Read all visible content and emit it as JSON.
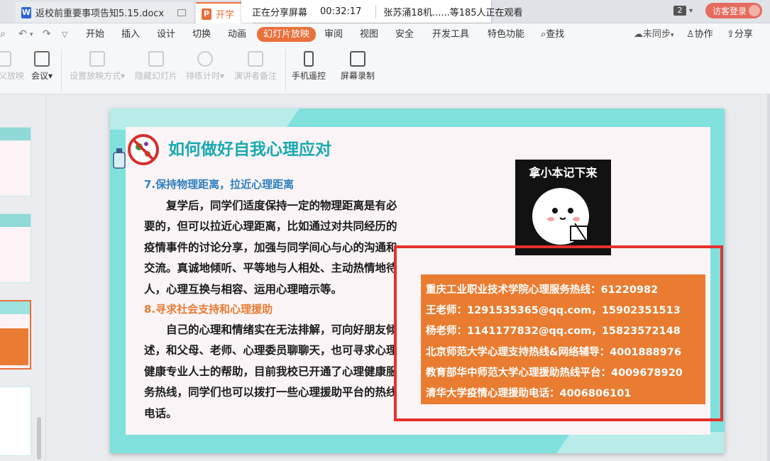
{
  "tabs": [
    {
      "label": "返校前重要事项告知5.15.docx",
      "icon": "W"
    },
    {
      "label": "开学",
      "icon": "P"
    }
  ],
  "share_bar": {
    "status": "正在分享屏幕",
    "time": "00:32:17",
    "viewers": "张苏涌18机......等185人正在观看"
  },
  "window_count": "2",
  "login_label": "访客登录",
  "menu": {
    "items": [
      "开始",
      "插入",
      "设计",
      "切换",
      "动画",
      "幻灯片放映",
      "审阅",
      "视图",
      "安全",
      "开发工具",
      "特色功能"
    ],
    "active": "幻灯片放映",
    "search": "查找",
    "sync": "未同步",
    "collab": "协作",
    "share": "分享"
  },
  "ribbon": {
    "partial_left": "义放映",
    "meeting": "会议",
    "set_show": "设置放映方式",
    "hide_slide": "隐藏幻灯片",
    "rehearse": "排练计时",
    "notes": "演讲者备注",
    "phone_remote": "手机遥控",
    "screen_record": "屏幕录制"
  },
  "slide": {
    "title": "如何做好自我心理应对",
    "sec7": {
      "heading": "7.保持物理距离，拉近心理距离",
      "text": "复学后，同学们适度保持一定的物理距离是有必要的，但可以拉近心理距离，比如通过对共同经历的疫情事件的讨论分享，加强与同学间心与心的沟通和交流。真诚地倾听、平等地与人相处、主动热情地待人，心理互换与相容、运用心理暗示等。"
    },
    "sec8": {
      "heading": "8.寻求社会支持和心理援助",
      "text": "自己的心理和情绪实在无法排解，可向好朋友倾述，和父母、老师、心理委员聊聊天，也可寻求心理健康专业人士的帮助，目前我校已开通了心理健康服务热线，同学们也可以拨打一些心理援助平台的热线电话。"
    },
    "sticker_text": "拿小本记下来",
    "hotlines": [
      "重庆工业职业技术学院心理服务热线：61220982",
      "王老师：1291535365@qq.com，15902351513",
      "杨老师：1141177832@qq.com，15823572148",
      "北京师范大学心理支持热线&网络辅导：4001888976",
      "教育部华中师范大学心理援助热线平台：4009678920",
      "清华大学疫情心理援助电话：4006806101"
    ]
  },
  "colors": {
    "accent": "#e9703a",
    "title_teal": "#17a9b0",
    "heading_blue": "#2f7fbd",
    "heading_orange": "#e97b33",
    "hotline_bg": "#e97c30",
    "highlight_red": "#e5302e"
  }
}
